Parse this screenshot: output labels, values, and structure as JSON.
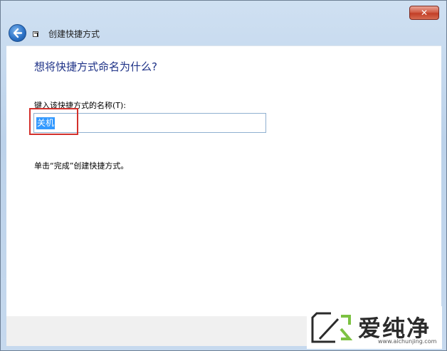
{
  "window": {
    "close_label": "✕"
  },
  "header": {
    "title": "创建快捷方式"
  },
  "main": {
    "heading": "想将快捷方式命名为什么?",
    "field_label": "键入该快捷方式的名称(T):",
    "name_value": "关机",
    "instruction": "单击“完成”创建快捷方式。"
  },
  "watermark": {
    "brand": "爱纯净",
    "url": "www.aichunjing.com"
  },
  "colors": {
    "heading": "#1e3287",
    "selection": "#3399ff",
    "highlight_box": "#d3302b",
    "close_button": "#c23e27"
  },
  "icons": {
    "back": "back-arrow-icon",
    "shortcut": "shortcut-icon"
  }
}
